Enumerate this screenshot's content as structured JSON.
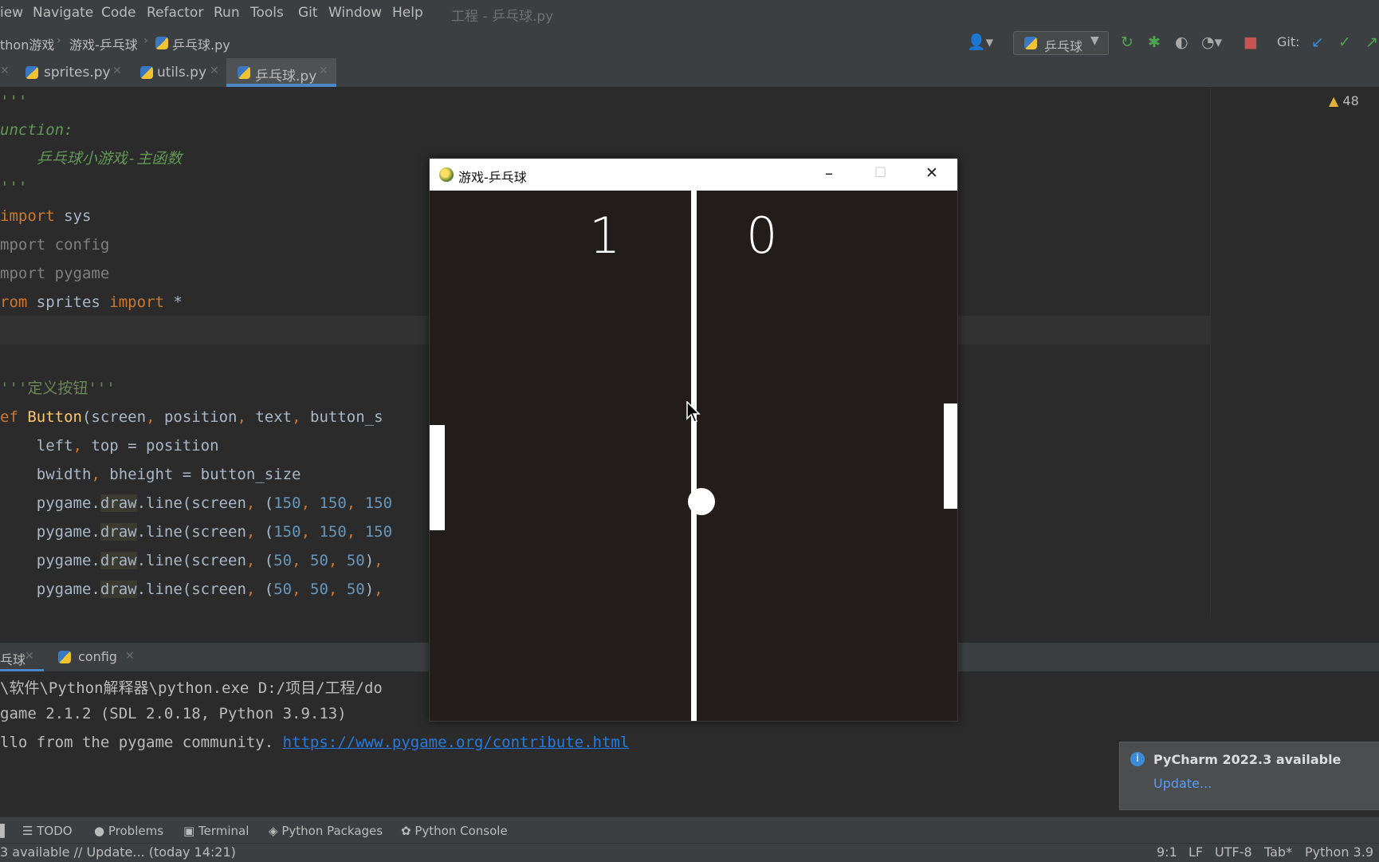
{
  "menu": {
    "items": [
      "iew",
      "Navigate",
      "Code",
      "Refactor",
      "Run",
      "Tools",
      "Git",
      "Window",
      "Help"
    ],
    "window_title": "工程 - 乒乓球.py"
  },
  "navbar": {
    "breadcrumbs": [
      "thon游戏",
      "游戏-乒乓球",
      "乒乓球.py"
    ],
    "run_config": "乒乓球",
    "git_label": "Git:"
  },
  "tabs": [
    {
      "label": "sprites.py",
      "active": false
    },
    {
      "label": "utils.py",
      "active": false
    },
    {
      "label": "乒乓球.py",
      "active": true
    }
  ],
  "editor": {
    "warnings_count": "48",
    "lines": [
      "'''",
      "unction:",
      "    乒乓球小游戏-主函数",
      "'''",
      "import sys",
      "mport config",
      "mport pygame",
      "rom sprites import *",
      "",
      "",
      "'''定义按钮'''",
      "ef Button(screen, position, text, button_s",
      "    left, top = position",
      "    bwidth, bheight = button_size",
      "    pygame.draw.line(screen, (150, 150, 150",
      "    pygame.draw.line(screen, (150, 150, 150",
      "    pygame.draw.line(screen, (50, 50, 50),",
      "    pygame.draw.line(screen, (50, 50, 50),"
    ]
  },
  "run_panel": {
    "tabs": [
      "乓球",
      "config"
    ],
    "output_lines": [
      "\\软件\\Python解释器\\python.exe D:/项目/工程/do",
      "game 2.1.2 (SDL 2.0.18, Python 3.9.13)",
      "llo from the pygame community. "
    ],
    "link": "https://www.pygame.org/contribute.html"
  },
  "bottom_toolbar": [
    "TODO",
    "Problems",
    "Terminal",
    "Python Packages",
    "Python Console"
  ],
  "status_bar": {
    "left": "3 available // Update... (today 14:21)",
    "position": "9:1",
    "line_sep": "LF",
    "encoding": "UTF-8",
    "indent": "Tab*",
    "interpreter": "Python 3.9"
  },
  "notification": {
    "title": "PyCharm 2022.3 available",
    "action": "Update..."
  },
  "game_window": {
    "title": "游戏-乒乓球",
    "score_left": "1",
    "score_right": "0",
    "minimize_glyph": "–",
    "maximize_glyph": "☐",
    "close_glyph": "✕"
  },
  "colors": {
    "ide_bg": "#2b2b2b",
    "chrome_bg": "#3c3f41",
    "accent": "#4a88c7",
    "game_bg": "#221d1b"
  }
}
